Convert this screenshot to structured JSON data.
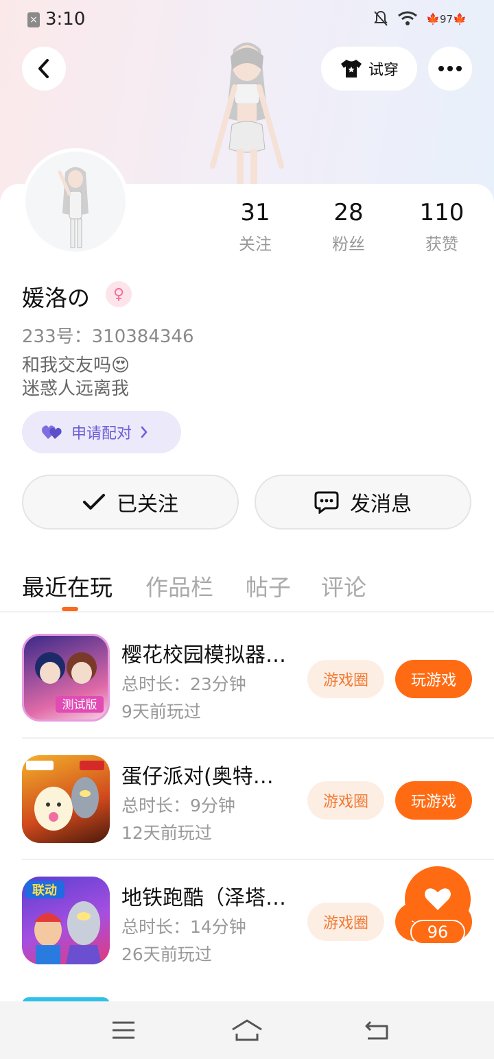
{
  "status_bar": {
    "time": "3:10",
    "battery": "97"
  },
  "header": {
    "tryon_label": "试穿"
  },
  "profile": {
    "stats": [
      {
        "num": "31",
        "label": "关注"
      },
      {
        "num": "28",
        "label": "粉丝"
      },
      {
        "num": "110",
        "label": "获赞"
      }
    ],
    "username": "媛洛の",
    "uid": "233号：310384346",
    "bio_line1": "和我交友吗😍",
    "bio_line2": "迷惑人远离我",
    "pair_label": "申请配对"
  },
  "actions": {
    "follow_label": "已关注",
    "message_label": "发消息"
  },
  "tabs": [
    "最近在玩",
    "作品栏",
    "帖子",
    "评论"
  ],
  "games": [
    {
      "name": "樱花校园模拟器…",
      "duration": "总时长：23分钟",
      "last_played": "9天前玩过",
      "circle_label": "游戏圈",
      "play_label": "玩游戏"
    },
    {
      "name": "蛋仔派对(奥特…",
      "duration": "总时长：9分钟",
      "last_played": "12天前玩过",
      "circle_label": "游戏圈",
      "play_label": "玩游戏"
    },
    {
      "name": "地铁跑酷（泽塔…",
      "duration": "总时长：14分钟",
      "last_played": "26天前玩过",
      "circle_label": "游戏圈",
      "play_label": "玩游戏"
    }
  ],
  "like_float": {
    "count": "96"
  },
  "game_icon_texts": {
    "badge_test": "测试版",
    "badge_link": "联动"
  },
  "colors": {
    "accent": "#ff6b13",
    "pair_purple": "#6b5ed6",
    "gender_pink": "#f36f95"
  }
}
